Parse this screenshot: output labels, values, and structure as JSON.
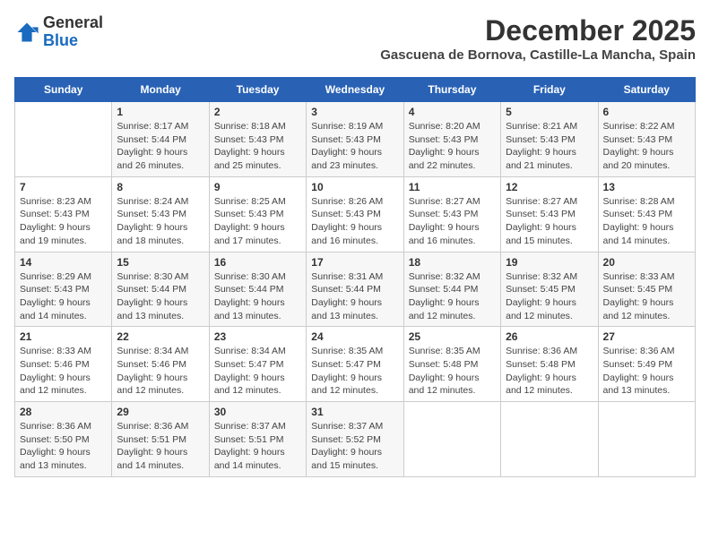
{
  "logo": {
    "line1": "General",
    "line2": "Blue"
  },
  "title": "December 2025",
  "location": "Gascuena de Bornova, Castille-La Mancha, Spain",
  "days_of_week": [
    "Sunday",
    "Monday",
    "Tuesday",
    "Wednesday",
    "Thursday",
    "Friday",
    "Saturday"
  ],
  "weeks": [
    [
      {
        "day": "",
        "sunrise": "",
        "sunset": "",
        "daylight": ""
      },
      {
        "day": "1",
        "sunrise": "Sunrise: 8:17 AM",
        "sunset": "Sunset: 5:44 PM",
        "daylight": "Daylight: 9 hours and 26 minutes."
      },
      {
        "day": "2",
        "sunrise": "Sunrise: 8:18 AM",
        "sunset": "Sunset: 5:43 PM",
        "daylight": "Daylight: 9 hours and 25 minutes."
      },
      {
        "day": "3",
        "sunrise": "Sunrise: 8:19 AM",
        "sunset": "Sunset: 5:43 PM",
        "daylight": "Daylight: 9 hours and 23 minutes."
      },
      {
        "day": "4",
        "sunrise": "Sunrise: 8:20 AM",
        "sunset": "Sunset: 5:43 PM",
        "daylight": "Daylight: 9 hours and 22 minutes."
      },
      {
        "day": "5",
        "sunrise": "Sunrise: 8:21 AM",
        "sunset": "Sunset: 5:43 PM",
        "daylight": "Daylight: 9 hours and 21 minutes."
      },
      {
        "day": "6",
        "sunrise": "Sunrise: 8:22 AM",
        "sunset": "Sunset: 5:43 PM",
        "daylight": "Daylight: 9 hours and 20 minutes."
      }
    ],
    [
      {
        "day": "7",
        "sunrise": "Sunrise: 8:23 AM",
        "sunset": "Sunset: 5:43 PM",
        "daylight": "Daylight: 9 hours and 19 minutes."
      },
      {
        "day": "8",
        "sunrise": "Sunrise: 8:24 AM",
        "sunset": "Sunset: 5:43 PM",
        "daylight": "Daylight: 9 hours and 18 minutes."
      },
      {
        "day": "9",
        "sunrise": "Sunrise: 8:25 AM",
        "sunset": "Sunset: 5:43 PM",
        "daylight": "Daylight: 9 hours and 17 minutes."
      },
      {
        "day": "10",
        "sunrise": "Sunrise: 8:26 AM",
        "sunset": "Sunset: 5:43 PM",
        "daylight": "Daylight: 9 hours and 16 minutes."
      },
      {
        "day": "11",
        "sunrise": "Sunrise: 8:27 AM",
        "sunset": "Sunset: 5:43 PM",
        "daylight": "Daylight: 9 hours and 16 minutes."
      },
      {
        "day": "12",
        "sunrise": "Sunrise: 8:27 AM",
        "sunset": "Sunset: 5:43 PM",
        "daylight": "Daylight: 9 hours and 15 minutes."
      },
      {
        "day": "13",
        "sunrise": "Sunrise: 8:28 AM",
        "sunset": "Sunset: 5:43 PM",
        "daylight": "Daylight: 9 hours and 14 minutes."
      }
    ],
    [
      {
        "day": "14",
        "sunrise": "Sunrise: 8:29 AM",
        "sunset": "Sunset: 5:43 PM",
        "daylight": "Daylight: 9 hours and 14 minutes."
      },
      {
        "day": "15",
        "sunrise": "Sunrise: 8:30 AM",
        "sunset": "Sunset: 5:44 PM",
        "daylight": "Daylight: 9 hours and 13 minutes."
      },
      {
        "day": "16",
        "sunrise": "Sunrise: 8:30 AM",
        "sunset": "Sunset: 5:44 PM",
        "daylight": "Daylight: 9 hours and 13 minutes."
      },
      {
        "day": "17",
        "sunrise": "Sunrise: 8:31 AM",
        "sunset": "Sunset: 5:44 PM",
        "daylight": "Daylight: 9 hours and 13 minutes."
      },
      {
        "day": "18",
        "sunrise": "Sunrise: 8:32 AM",
        "sunset": "Sunset: 5:44 PM",
        "daylight": "Daylight: 9 hours and 12 minutes."
      },
      {
        "day": "19",
        "sunrise": "Sunrise: 8:32 AM",
        "sunset": "Sunset: 5:45 PM",
        "daylight": "Daylight: 9 hours and 12 minutes."
      },
      {
        "day": "20",
        "sunrise": "Sunrise: 8:33 AM",
        "sunset": "Sunset: 5:45 PM",
        "daylight": "Daylight: 9 hours and 12 minutes."
      }
    ],
    [
      {
        "day": "21",
        "sunrise": "Sunrise: 8:33 AM",
        "sunset": "Sunset: 5:46 PM",
        "daylight": "Daylight: 9 hours and 12 minutes."
      },
      {
        "day": "22",
        "sunrise": "Sunrise: 8:34 AM",
        "sunset": "Sunset: 5:46 PM",
        "daylight": "Daylight: 9 hours and 12 minutes."
      },
      {
        "day": "23",
        "sunrise": "Sunrise: 8:34 AM",
        "sunset": "Sunset: 5:47 PM",
        "daylight": "Daylight: 9 hours and 12 minutes."
      },
      {
        "day": "24",
        "sunrise": "Sunrise: 8:35 AM",
        "sunset": "Sunset: 5:47 PM",
        "daylight": "Daylight: 9 hours and 12 minutes."
      },
      {
        "day": "25",
        "sunrise": "Sunrise: 8:35 AM",
        "sunset": "Sunset: 5:48 PM",
        "daylight": "Daylight: 9 hours and 12 minutes."
      },
      {
        "day": "26",
        "sunrise": "Sunrise: 8:36 AM",
        "sunset": "Sunset: 5:48 PM",
        "daylight": "Daylight: 9 hours and 12 minutes."
      },
      {
        "day": "27",
        "sunrise": "Sunrise: 8:36 AM",
        "sunset": "Sunset: 5:49 PM",
        "daylight": "Daylight: 9 hours and 13 minutes."
      }
    ],
    [
      {
        "day": "28",
        "sunrise": "Sunrise: 8:36 AM",
        "sunset": "Sunset: 5:50 PM",
        "daylight": "Daylight: 9 hours and 13 minutes."
      },
      {
        "day": "29",
        "sunrise": "Sunrise: 8:36 AM",
        "sunset": "Sunset: 5:51 PM",
        "daylight": "Daylight: 9 hours and 14 minutes."
      },
      {
        "day": "30",
        "sunrise": "Sunrise: 8:37 AM",
        "sunset": "Sunset: 5:51 PM",
        "daylight": "Daylight: 9 hours and 14 minutes."
      },
      {
        "day": "31",
        "sunrise": "Sunrise: 8:37 AM",
        "sunset": "Sunset: 5:52 PM",
        "daylight": "Daylight: 9 hours and 15 minutes."
      },
      {
        "day": "",
        "sunrise": "",
        "sunset": "",
        "daylight": ""
      },
      {
        "day": "",
        "sunrise": "",
        "sunset": "",
        "daylight": ""
      },
      {
        "day": "",
        "sunrise": "",
        "sunset": "",
        "daylight": ""
      }
    ]
  ]
}
